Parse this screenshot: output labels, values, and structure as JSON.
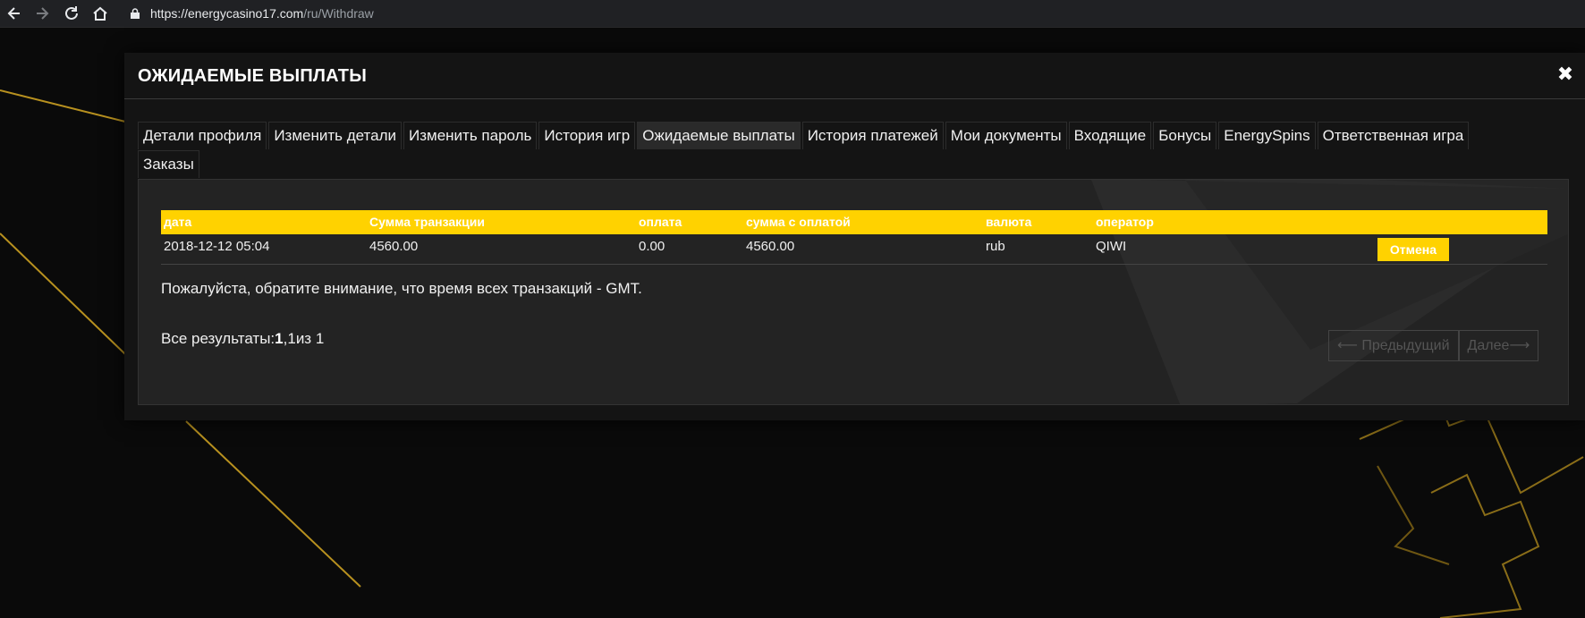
{
  "browser": {
    "url_domain": "https://energycasino17.com",
    "url_path": "/ru/Withdraw",
    "back_icon": "arrow-left-icon",
    "forward_icon": "arrow-right-icon",
    "reload_icon": "reload-icon",
    "home_icon": "home-icon"
  },
  "modal": {
    "title": "ОЖИДАЕМЫЕ ВЫПЛАТЫ",
    "close_glyph": "✖"
  },
  "tabs": [
    {
      "label": "Детали профиля"
    },
    {
      "label": "Изменить детали"
    },
    {
      "label": "Изменить пароль"
    },
    {
      "label": "История игр"
    },
    {
      "label": "Ожидаемые выплаты",
      "active": true
    },
    {
      "label": "История платежей"
    },
    {
      "label": "Мои документы"
    },
    {
      "label": "Входящие"
    },
    {
      "label": "Бонусы"
    },
    {
      "label": "EnergySpins"
    },
    {
      "label": "Ответственная игра"
    },
    {
      "label": "Заказы"
    }
  ],
  "table": {
    "headers": {
      "date": "дата",
      "amount": "Сумма транзакции",
      "fee": "оплата",
      "total": "сумма с оплатой",
      "currency": "валюта",
      "operator": "оператор"
    },
    "rows": [
      {
        "date": "2018-12-12 05:04",
        "amount": "4560.00",
        "fee": "0.00",
        "total": "4560.00",
        "currency": "rub",
        "operator": "QIWI",
        "action_label": "Отмена"
      }
    ]
  },
  "note": "Пожалуйста, обратите внимание, что время всех транзакций - GMT.",
  "results": {
    "label": "Все результаты:",
    "shown": "1",
    "sep": ",",
    "current": "1",
    "of_text": "из 1"
  },
  "pager": {
    "prev_label": "⟵ Предыдущий",
    "next_label": "Далее⟶"
  },
  "colors": {
    "accent": "#ffd200",
    "modal_bg": "#141414",
    "panel_bg": "#232323",
    "page_bg": "#0a0a0a"
  }
}
